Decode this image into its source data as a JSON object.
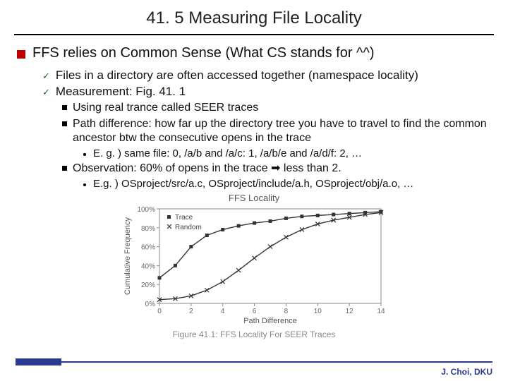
{
  "title": "41. 5 Measuring File Locality",
  "lvl1": "FFS relies on Common Sense (What CS stands for ^^)",
  "lvl2": {
    "a": "Files in a directory are often accessed together (namespace locality)",
    "b": "Measurement: Fig. 41. 1"
  },
  "lvl3": {
    "a": "Using real trance called SEER traces",
    "b": "Path difference: how far up the directory tree you have to travel to find the common ancestor btw the consecutive opens in the trace",
    "c": "Observation: 60% of opens in the trace ➡ less than 2."
  },
  "lvl4": {
    "a": "E. g. ) same file: 0, /a/b and /a/c: 1, /a/b/e and /a/d/f: 2, …",
    "b": "E.g. ) OSproject/src/a.c, OSproject/include/a.h, OSproject/obj/a.o, …"
  },
  "footer": "J. Choi, DKU",
  "chart_data": {
    "type": "line",
    "title": "FFS Locality",
    "caption": "Figure 41.1: FFS Locality For SEER Traces",
    "xlabel": "Path Difference",
    "ylabel": "Cumulative Frequency",
    "xlim": [
      0,
      14
    ],
    "ylim": [
      0,
      100
    ],
    "xticks": [
      0,
      2,
      4,
      6,
      8,
      10,
      12,
      14
    ],
    "yticks": {
      "0": "0%",
      "20": "20%",
      "40": "40%",
      "60": "60%",
      "80": "80%",
      "100": "100%"
    },
    "series": [
      {
        "name": "Trace",
        "marker": "square",
        "x": [
          0,
          1,
          2,
          3,
          4,
          5,
          6,
          7,
          8,
          9,
          10,
          11,
          12,
          13,
          14
        ],
        "y": [
          27,
          40,
          60,
          72,
          78,
          82,
          85,
          87,
          90,
          92,
          93,
          94,
          95,
          96,
          97
        ]
      },
      {
        "name": "Random",
        "marker": "x",
        "x": [
          0,
          1,
          2,
          3,
          4,
          5,
          6,
          7,
          8,
          9,
          10,
          11,
          12,
          13,
          14
        ],
        "y": [
          4,
          5,
          8,
          14,
          23,
          35,
          48,
          60,
          70,
          78,
          84,
          88,
          91,
          94,
          96
        ]
      }
    ]
  }
}
